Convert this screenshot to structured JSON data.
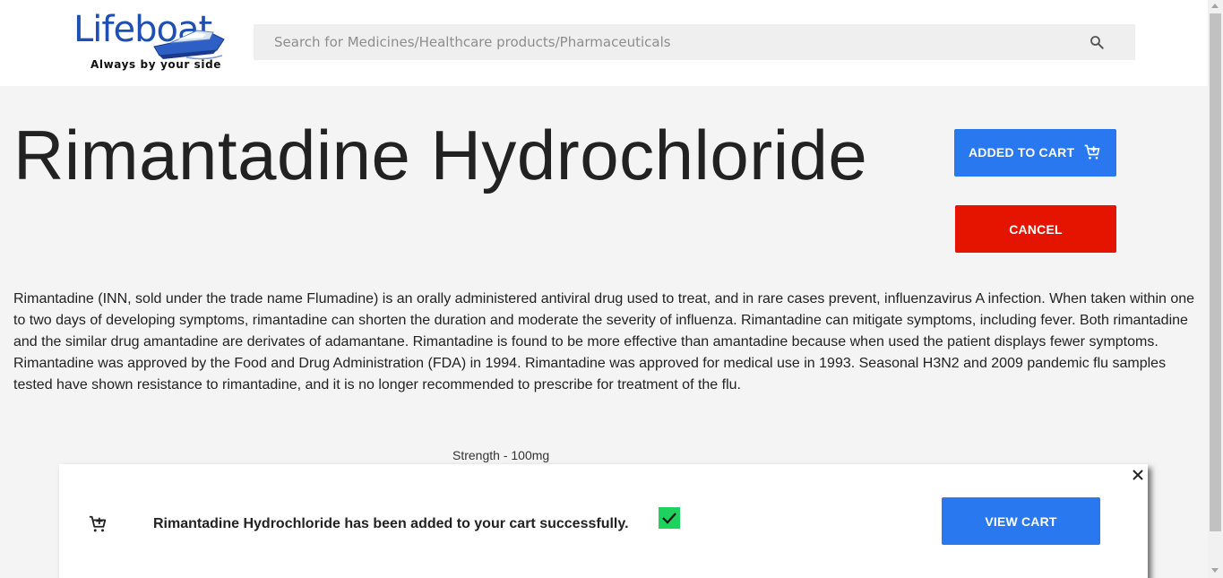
{
  "header": {
    "logo_word": "Lifeboat",
    "logo_tagline": "Always by your side",
    "search_placeholder": "Search for Medicines/Healthcare products/Pharmaceuticals",
    "search_icon": "search-icon"
  },
  "product": {
    "title": "Rimantadine Hydrochloride",
    "added_label": "ADDED TO CART",
    "cancel_label": "CANCEL",
    "description": "Rimantadine (INN, sold under the trade name Flumadine) is an orally administered antiviral drug used to treat, and in rare cases prevent, influenzavirus A infection. When taken within one to two days of developing symptoms, rimantadine can shorten the duration and moderate the severity of influenza. Rimantadine can mitigate symptoms, including fever. Both rimantadine and the similar drug amantadine are derivates of adamantane. Rimantadine is found to be more effective than amantadine because when used the patient displays fewer symptoms. Rimantadine was approved by the Food and Drug Administration (FDA) in 1994. Rimantadine was approved for medical use in 1993. Seasonal H3N2 and 2009 pandemic flu samples tested have shown resistance to rimantadine, and it is no longer recommended to prescribe for treatment of the flu.",
    "strength": "Strength - 100mg"
  },
  "toast": {
    "message": "Rimantadine Hydrochloride has been added to your cart successfully.",
    "view_cart_label": "VIEW CART"
  },
  "colors": {
    "primary_blue": "#2a78f0",
    "cancel_red": "#e51400",
    "success_green": "#1fd15f",
    "logo_blue": "#1e4fb4"
  },
  "icons": [
    "search-icon",
    "add-cart-icon",
    "close-icon",
    "checkmark-icon",
    "boat-icon"
  ]
}
